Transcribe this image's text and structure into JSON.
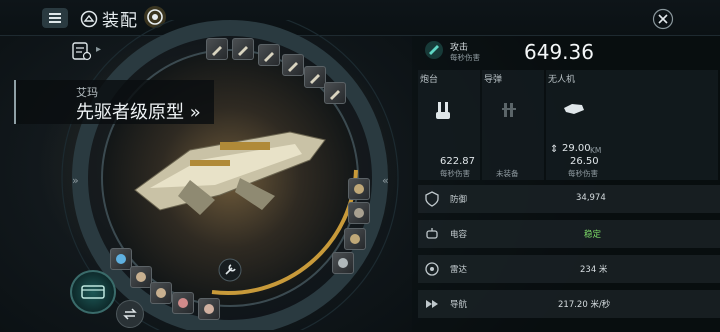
{
  "header": {
    "title": "装配",
    "menu_icon": "menu-icon",
    "title_icon": "fitting-icon",
    "target_icon": "target-icon",
    "close_icon": "close-icon"
  },
  "ship": {
    "subtitle": "艾玛",
    "name": "先驱者级原型",
    "name_suffix": "»"
  },
  "nav": {
    "left_chevron": "»",
    "right_chevron": "«",
    "small_arrow": "▸"
  },
  "attack": {
    "label": "攻击",
    "sub": "每秒伤害",
    "value": "649.36"
  },
  "weapons": [
    {
      "label": "炮台",
      "value": "622.87",
      "sub": "每秒伤害",
      "icon": "turret-icon"
    },
    {
      "label": "导弹",
      "value": "",
      "sub": "未装备",
      "icon": "missile-icon"
    },
    {
      "label": "无人机",
      "range": "29.00",
      "range_unit": "KM",
      "value": "26.50",
      "sub": "每秒伤害",
      "icon": "drone-icon"
    }
  ],
  "stats": [
    {
      "label": "防御",
      "value": "34,974",
      "icon": "shield-icon"
    },
    {
      "label": "电容",
      "value": "稳定",
      "icon": "capacitor-icon"
    },
    {
      "label": "雷达",
      "value": "234 米",
      "icon": "radar-icon"
    },
    {
      "label": "导航",
      "value": "217.20 米/秒",
      "icon": "navigation-icon"
    }
  ],
  "colors": {
    "accent": "#3fb6a8",
    "stable": "#7fe06a",
    "bg": "#0a0f12",
    "ring_highlight": "#c89a3a"
  }
}
